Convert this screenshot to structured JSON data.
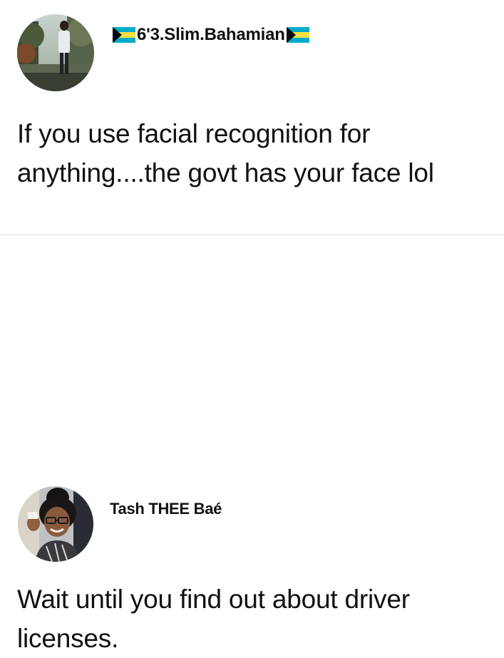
{
  "posts": [
    {
      "username": "6'3.Slim.Bahamian",
      "username_decorations": [
        "bahamas-flag-icon",
        "bahamas-flag-icon"
      ],
      "text": "If you use facial recognition for anything....the govt has your face lol"
    },
    {
      "username": "Tash THEE Baé",
      "text": "Wait until you find out about driver licenses."
    }
  ],
  "colors": {
    "text": "#111111",
    "background": "#ffffff",
    "divider": "#e2e2e2",
    "flag_aquamarine": "#00abc9",
    "flag_gold": "#fae042",
    "flag_black": "#000000"
  }
}
